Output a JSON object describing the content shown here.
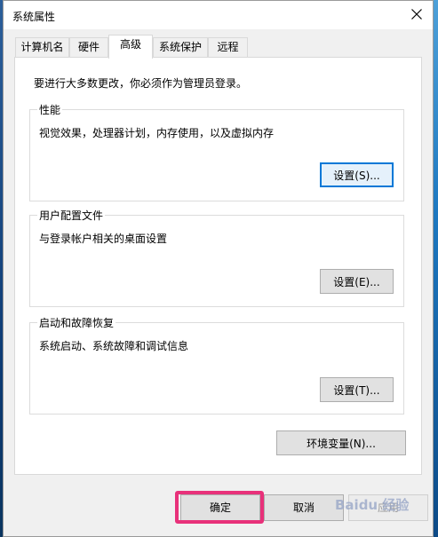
{
  "window": {
    "title": "系统属性"
  },
  "tabs": [
    {
      "label": "计算机名"
    },
    {
      "label": "硬件"
    },
    {
      "label": "高级"
    },
    {
      "label": "系统保护"
    },
    {
      "label": "远程"
    }
  ],
  "active_tab": "高级",
  "notice": "要进行大多数更改，你必须作为管理员登录。",
  "groups": {
    "performance": {
      "title": "性能",
      "description": "视觉效果，处理器计划，内存使用，以及虚拟内存",
      "button": "设置(S)..."
    },
    "user_profiles": {
      "title": "用户配置文件",
      "description": "与登录帐户相关的桌面设置",
      "button": "设置(E)..."
    },
    "startup_recovery": {
      "title": "启动和故障恢复",
      "description": "系统启动、系统故障和调试信息",
      "button": "设置(T)..."
    }
  },
  "env_button": "环境变量(N)...",
  "footer": {
    "ok": "确定",
    "cancel": "取消",
    "apply": "应用"
  },
  "watermark": "Baidu 经验",
  "colors": {
    "highlight": "#e8317a",
    "focus": "#0078d7"
  }
}
